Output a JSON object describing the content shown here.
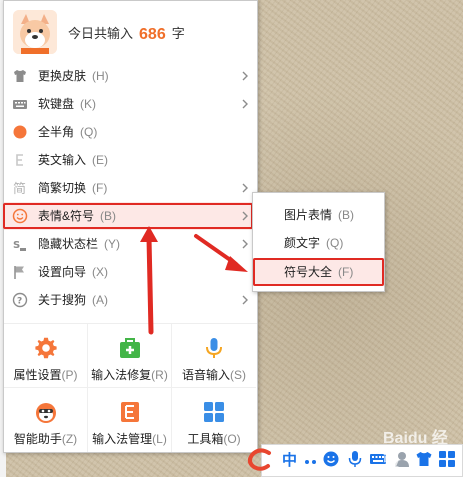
{
  "header": {
    "prefix": "今日共输入",
    "count": "686",
    "suffix": "字"
  },
  "menu": {
    "items": [
      {
        "label": "更换皮肤",
        "hotkey": "(H)",
        "icon": "shirt-icon"
      },
      {
        "label": "软键盘",
        "hotkey": "(K)",
        "icon": "keyboard-icon"
      },
      {
        "label": "全半角",
        "hotkey": "(Q)",
        "icon": "dot-icon"
      },
      {
        "label": "英文输入",
        "hotkey": "(E)",
        "icon": "english-e-icon"
      },
      {
        "label": "简繁切换",
        "hotkey": "(F)",
        "icon": "jian-char-icon"
      },
      {
        "label": "表情&符号",
        "hotkey": "(B)",
        "icon": "smiley-icon"
      },
      {
        "label": "隐藏状态栏",
        "hotkey": "(Y)",
        "icon": "hide-statusbar-icon"
      },
      {
        "label": "设置向导",
        "hotkey": "(X)",
        "icon": "flag-icon"
      },
      {
        "label": "关于搜狗",
        "hotkey": "(A)",
        "icon": "question-icon"
      }
    ]
  },
  "grid": {
    "cells": [
      {
        "label": "属性设置",
        "hotkey": "(P)",
        "icon": "gear-icon"
      },
      {
        "label": "输入法修复",
        "hotkey": "(R)",
        "icon": "repair-kit-icon"
      },
      {
        "label": "语音输入",
        "hotkey": "(S)",
        "icon": "microphone-icon"
      },
      {
        "label": "智能助手",
        "hotkey": "(Z)",
        "icon": "assistant-mascot-icon"
      },
      {
        "label": "输入法管理",
        "hotkey": "(L)",
        "icon": "manage-icon"
      },
      {
        "label": "工具箱",
        "hotkey": "(O)",
        "icon": "toolbox-grid-icon"
      }
    ]
  },
  "submenu": {
    "items": [
      {
        "label": "图片表情",
        "hotkey": "(B)"
      },
      {
        "label": "颜文字",
        "hotkey": "(Q)"
      },
      {
        "label": "符号大全",
        "hotkey": "(F)"
      }
    ]
  },
  "statusbar": {
    "mode": "中",
    "icons": [
      "sogou-logo-icon",
      "punctuation-icon",
      "smiley-icon",
      "microphone-icon",
      "keyboard-icon",
      "user-icon",
      "shirt-icon",
      "toolbox-icon"
    ]
  },
  "watermark": "Baidu 经验",
  "colors": {
    "accent_orange": "#f06f2a",
    "highlight_red": "#e02a23",
    "active_bg": "#fde8e6",
    "statusbar_blue": "#1a73e8"
  }
}
